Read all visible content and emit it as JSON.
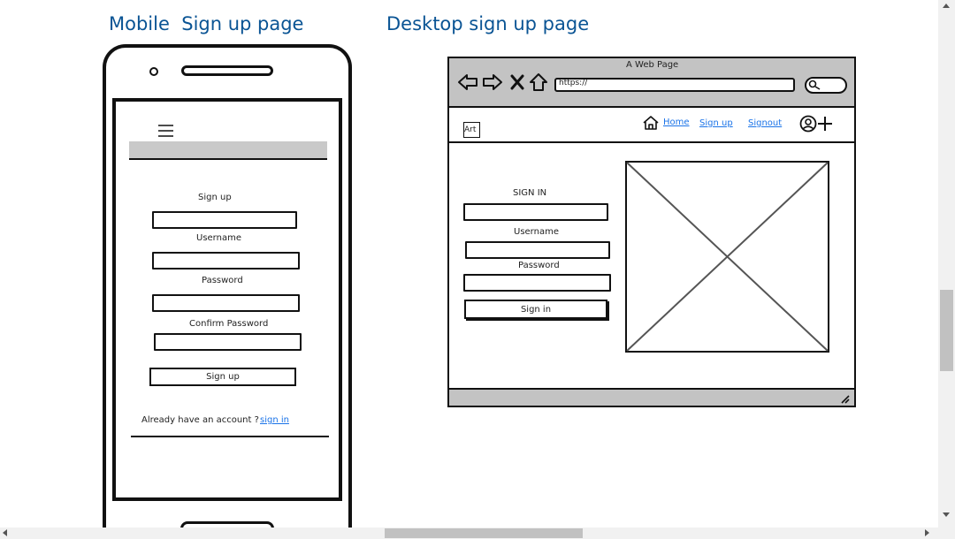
{
  "titles": {
    "mobile": "Mobile  Sign up page",
    "desktop": "Desktop sign up page"
  },
  "mobile": {
    "menu_icon": "hamburger-icon",
    "heading": "Sign up",
    "username_label": "Username",
    "password_label": "Password",
    "confirm_label": "Confirm Password",
    "submit_label": "Sign up",
    "account_prompt": "Already have an account ?",
    "signin_link": "sign in"
  },
  "desktop": {
    "window_title": "A Web Page",
    "url": "https://",
    "logo": "Art",
    "nav": {
      "home": "Home",
      "signup": "Sign up",
      "signout": "Signout"
    },
    "form": {
      "heading": "SIGN IN",
      "username_label": "Username",
      "password_label": "Password",
      "submit_label": "Sign in"
    },
    "image_placeholder_icon": "image-placeholder-icon"
  },
  "colors": {
    "title": "#0a5494",
    "chrome_gray": "#c3c3c3",
    "link": "#1a73e8"
  }
}
